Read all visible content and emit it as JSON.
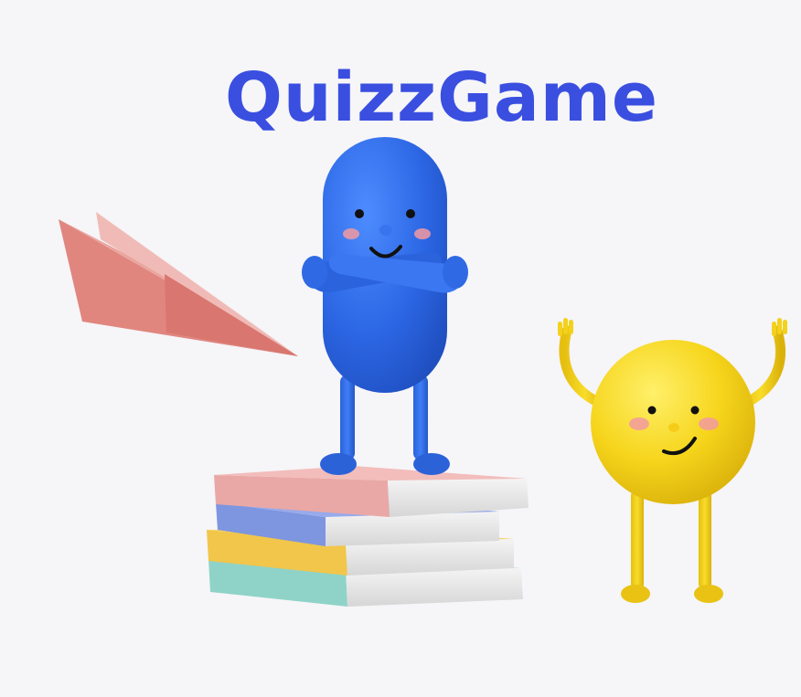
{
  "app": {
    "title": "QuizzGame"
  },
  "illustration": {
    "items": [
      "paper-plane-icon",
      "blue-pill-character",
      "book-stack",
      "yellow-ball-character"
    ]
  },
  "colors": {
    "background": "#f6f5f8",
    "title": "#3a4fe0",
    "blue_character": "#2f6fe8",
    "yellow_character": "#f4d21a",
    "paper_plane": "#e28b86",
    "book_pink": "#e9a8a6",
    "book_blue": "#7e95e0",
    "book_yellow": "#f1c64a",
    "book_teal": "#8fd3c8"
  }
}
